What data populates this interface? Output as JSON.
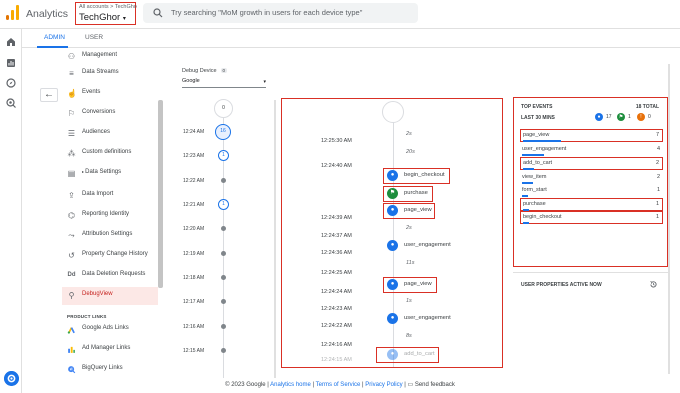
{
  "header": {
    "app_title": "Analytics",
    "breadcrumb": "All accounts > TechGho",
    "account_name": "TechGhor",
    "account_caret": "▾",
    "search_placeholder": "Try searching \"MoM growth in users for each device type\""
  },
  "tabs": [
    {
      "label": "ADMIN",
      "active": true
    },
    {
      "label": "USER",
      "active": false
    }
  ],
  "sidebar": {
    "items": [
      {
        "label": "Management",
        "icon": "people-icon"
      },
      {
        "label": "Data Streams",
        "icon": "streams-icon"
      },
      {
        "label": "Events",
        "icon": "touch-icon"
      },
      {
        "label": "Conversions",
        "icon": "flag-icon"
      },
      {
        "label": "Audiences",
        "icon": "audience-icon"
      },
      {
        "label": "Custom definitions",
        "icon": "custom-definitions-icon"
      },
      {
        "label": "Data Settings",
        "icon": "database-icon"
      },
      {
        "label": "Data Import",
        "icon": "upload-icon"
      },
      {
        "label": "Reporting Identity",
        "icon": "identity-icon"
      },
      {
        "label": "Attribution Settings",
        "icon": "attribution-icon"
      },
      {
        "label": "Property Change History",
        "icon": "history-icon"
      },
      {
        "label": "Data Deletion Requests",
        "icon": "dd-icon"
      },
      {
        "label": "DebugView",
        "icon": "debug-icon",
        "active": true
      }
    ],
    "product_links_heading": "PRODUCT LINKS",
    "product_links": [
      {
        "label": "Google Ads Links",
        "icon": "google-ads-icon"
      },
      {
        "label": "Ad Manager Links",
        "icon": "ad-manager-icon"
      },
      {
        "label": "BigQuery Links",
        "icon": "bigquery-icon"
      }
    ]
  },
  "debug_device": {
    "label": "Debug Device",
    "count": "0",
    "selected": "Google",
    "caret": "▾"
  },
  "minutes_timeline": {
    "top_count": "0",
    "rows": [
      {
        "time": "12:24 AM",
        "marker": "active",
        "count": "16"
      },
      {
        "time": "12:23 AM",
        "marker": "circle",
        "count": "1"
      },
      {
        "time": "12:22 AM",
        "marker": "dot"
      },
      {
        "time": "12:21 AM",
        "marker": "circle",
        "count": "1"
      },
      {
        "time": "12:20 AM",
        "marker": "dot"
      },
      {
        "time": "12:19 AM",
        "marker": "dot"
      },
      {
        "time": "12:18 AM",
        "marker": "dot"
      },
      {
        "time": "12:17 AM",
        "marker": "dot"
      },
      {
        "time": "12:16 AM",
        "marker": "dot"
      },
      {
        "time": "12:15 AM",
        "marker": "dot"
      }
    ]
  },
  "event_stream": {
    "gaps": [
      "2s",
      "20s",
      "2s",
      "11s",
      "1s",
      "8s"
    ],
    "times": [
      "12:25:30 AM",
      "12:24:40 AM",
      "12:24:39 AM",
      "12:24:37 AM",
      "12:24:36 AM",
      "12:24:25 AM",
      "12:24:24 AM",
      "12:24:23 AM",
      "12:24:22 AM",
      "12:24:16 AM",
      "12:24:15 AM"
    ],
    "events": [
      {
        "name": "begin_checkout",
        "icon": "user-icon",
        "highlighted": true
      },
      {
        "name": "purchase",
        "icon": "conversion-flag-icon",
        "highlighted": true
      },
      {
        "name": "page_view",
        "icon": "user-icon",
        "highlighted": true
      },
      {
        "name": "user_engagement",
        "icon": "user-icon",
        "highlighted": false
      },
      {
        "name": "page_view",
        "icon": "user-icon",
        "highlighted": true
      },
      {
        "name": "user_engagement",
        "icon": "user-icon",
        "highlighted": false
      },
      {
        "name": "add_to_cart",
        "icon": "user-icon",
        "highlighted": true
      }
    ]
  },
  "top_events": {
    "heading": "TOP EVENTS",
    "total": "18 TOTAL",
    "subheading": "LAST 30 MINS",
    "badges": [
      {
        "count": "17",
        "color": "#1a73e8",
        "icon": "user-badge-icon"
      },
      {
        "count": "1",
        "color": "#1e8e3e",
        "icon": "conversion-badge-icon"
      },
      {
        "count": "0",
        "color": "#e8710a",
        "icon": "error-badge-icon"
      }
    ],
    "rows": [
      {
        "name": "page_view",
        "count": "7",
        "highlighted": true
      },
      {
        "name": "user_engagement",
        "count": "4",
        "highlighted": false
      },
      {
        "name": "add_to_cart",
        "count": "2",
        "highlighted": true
      },
      {
        "name": "view_item",
        "count": "2",
        "highlighted": false
      },
      {
        "name": "form_start",
        "count": "1",
        "highlighted": false
      },
      {
        "name": "purchase",
        "count": "1",
        "highlighted": true
      },
      {
        "name": "begin_checkout",
        "count": "1",
        "highlighted": true
      }
    ]
  },
  "user_properties": {
    "heading": "USER PROPERTIES ACTIVE NOW"
  },
  "footer": {
    "copyright": "© 2023 Google |",
    "links": [
      "Analytics home",
      "Terms of Service",
      "Privacy Policy"
    ],
    "feedback": "Send feedback"
  },
  "colors": {
    "accent": "#1a73e8",
    "highlight_box": "#d93025",
    "conversion": "#1e8e3e",
    "error": "#e8710a"
  }
}
